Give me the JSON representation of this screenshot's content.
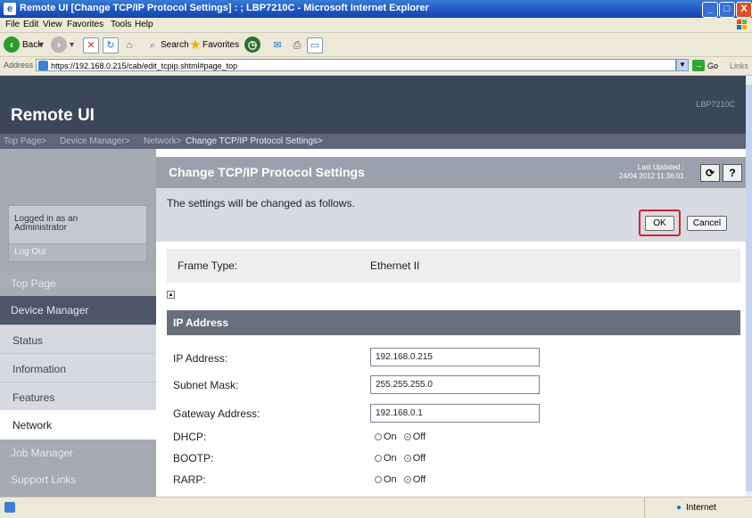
{
  "window": {
    "title": "Remote UI [Change TCP/IP Protocol Settings] : ; LBP7210C - Microsoft Internet Explorer",
    "controls": [
      "_",
      "□",
      "X"
    ]
  },
  "menu": [
    "File",
    "Edit",
    "View",
    "Favorites",
    "Tools",
    "Help"
  ],
  "toolbar": {
    "back": "Back",
    "search": "Search",
    "favorites": "Favorites"
  },
  "address": {
    "label": "Address",
    "url": "https://192.168.0.215/cab/edit_tcpip.shtml#page_top",
    "go": "Go",
    "links": "Links"
  },
  "header": {
    "logo": "Remote UI",
    "model": "LBP7210C"
  },
  "breadcrumb": [
    "Top Page>",
    "Device Manager>",
    "Network>",
    "Change TCP/IP Protocol Settings>"
  ],
  "sidebar": {
    "login": {
      "line1": "Logged in as an",
      "line2": "Administrator"
    },
    "logout": "Log Out",
    "top_page": "Top Page",
    "device_manager": "Device Manager",
    "items": [
      {
        "label": "Status"
      },
      {
        "label": "Information"
      },
      {
        "label": "Features"
      },
      {
        "label": "Network"
      }
    ],
    "job_manager": "Job Manager",
    "support_links": "Support Links"
  },
  "content": {
    "title": "Change TCP/IP Protocol Settings",
    "last_updated_label": "Last Updated :",
    "last_updated_value": "24/04 2012 11:36:01",
    "message": "The settings will be changed as follows.",
    "ok": "OK",
    "cancel": "Cancel",
    "frame_type_label": "Frame Type:",
    "frame_type_value": "Ethernet II",
    "section_ip": "IP Address",
    "ip_label": "IP Address:",
    "ip_value": "192.168.0.215",
    "subnet_label": "Subnet Mask:",
    "subnet_value": "255.255.255.0",
    "gateway_label": "Gateway Address:",
    "gateway_value": "192.168.0.1",
    "dhcp_label": "DHCP:",
    "bootp_label": "BOOTP:",
    "rarp_label": "RARP:",
    "radio_on": "On",
    "radio_off": "Off"
  },
  "status": {
    "zone": "Internet"
  }
}
